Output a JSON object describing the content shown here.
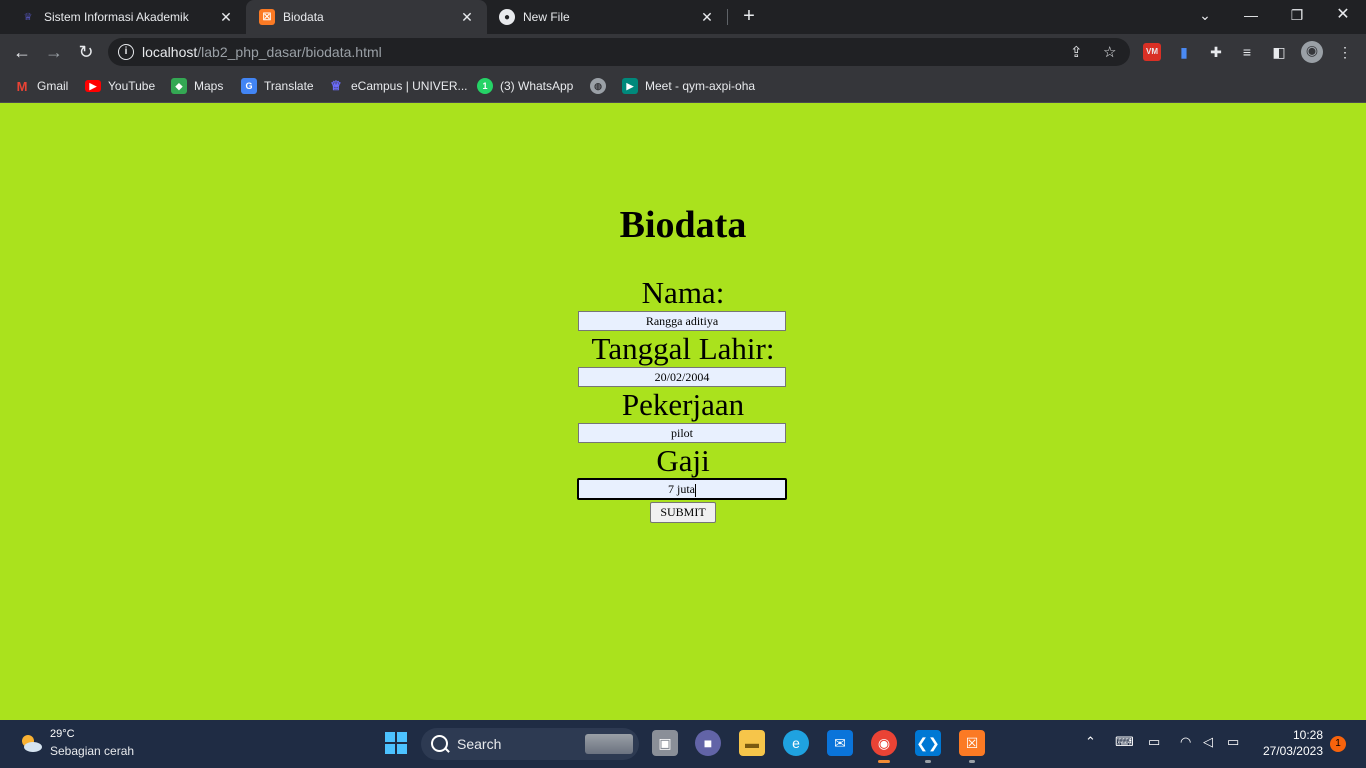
{
  "browser": {
    "tabs": [
      {
        "title": "Sistem Informasi Akademik",
        "favicon": "campus-icon"
      },
      {
        "title": "Biodata",
        "favicon": "xampp-icon"
      },
      {
        "title": "New File",
        "favicon": "github-icon"
      }
    ],
    "active_tab": 1,
    "url": {
      "host": "localhost",
      "path": "/lab2_php_dasar/biodata.html"
    },
    "bookmarks": [
      {
        "label": "Gmail",
        "icon": "gmail-icon"
      },
      {
        "label": "YouTube",
        "icon": "youtube-icon"
      },
      {
        "label": "Maps",
        "icon": "maps-icon"
      },
      {
        "label": "Translate",
        "icon": "translate-icon"
      },
      {
        "label": "eCampus | UNIVER...",
        "icon": "campus-icon"
      },
      {
        "label": "(3) WhatsApp",
        "icon": "whatsapp-icon"
      },
      {
        "label": "",
        "icon": "globe-icon"
      },
      {
        "label": "Meet - qym-axpi-oha",
        "icon": "meet-icon"
      }
    ]
  },
  "page": {
    "background": "#aae21d",
    "heading": "Biodata",
    "fields": [
      {
        "label": "Nama:",
        "value": "Rangga aditiya"
      },
      {
        "label": "Tanggal Lahir:",
        "value": "20/02/2004"
      },
      {
        "label": "Pekerjaan",
        "value": "pilot"
      },
      {
        "label": "Gaji",
        "value": "7 juta"
      }
    ],
    "submit_label": "SUBMIT"
  },
  "taskbar": {
    "weather": {
      "temp": "29°C",
      "desc": "Sebagian cerah"
    },
    "search_placeholder": "Search",
    "clock": {
      "time": "10:28",
      "date": "27/03/2023"
    },
    "notification_count": "1"
  }
}
